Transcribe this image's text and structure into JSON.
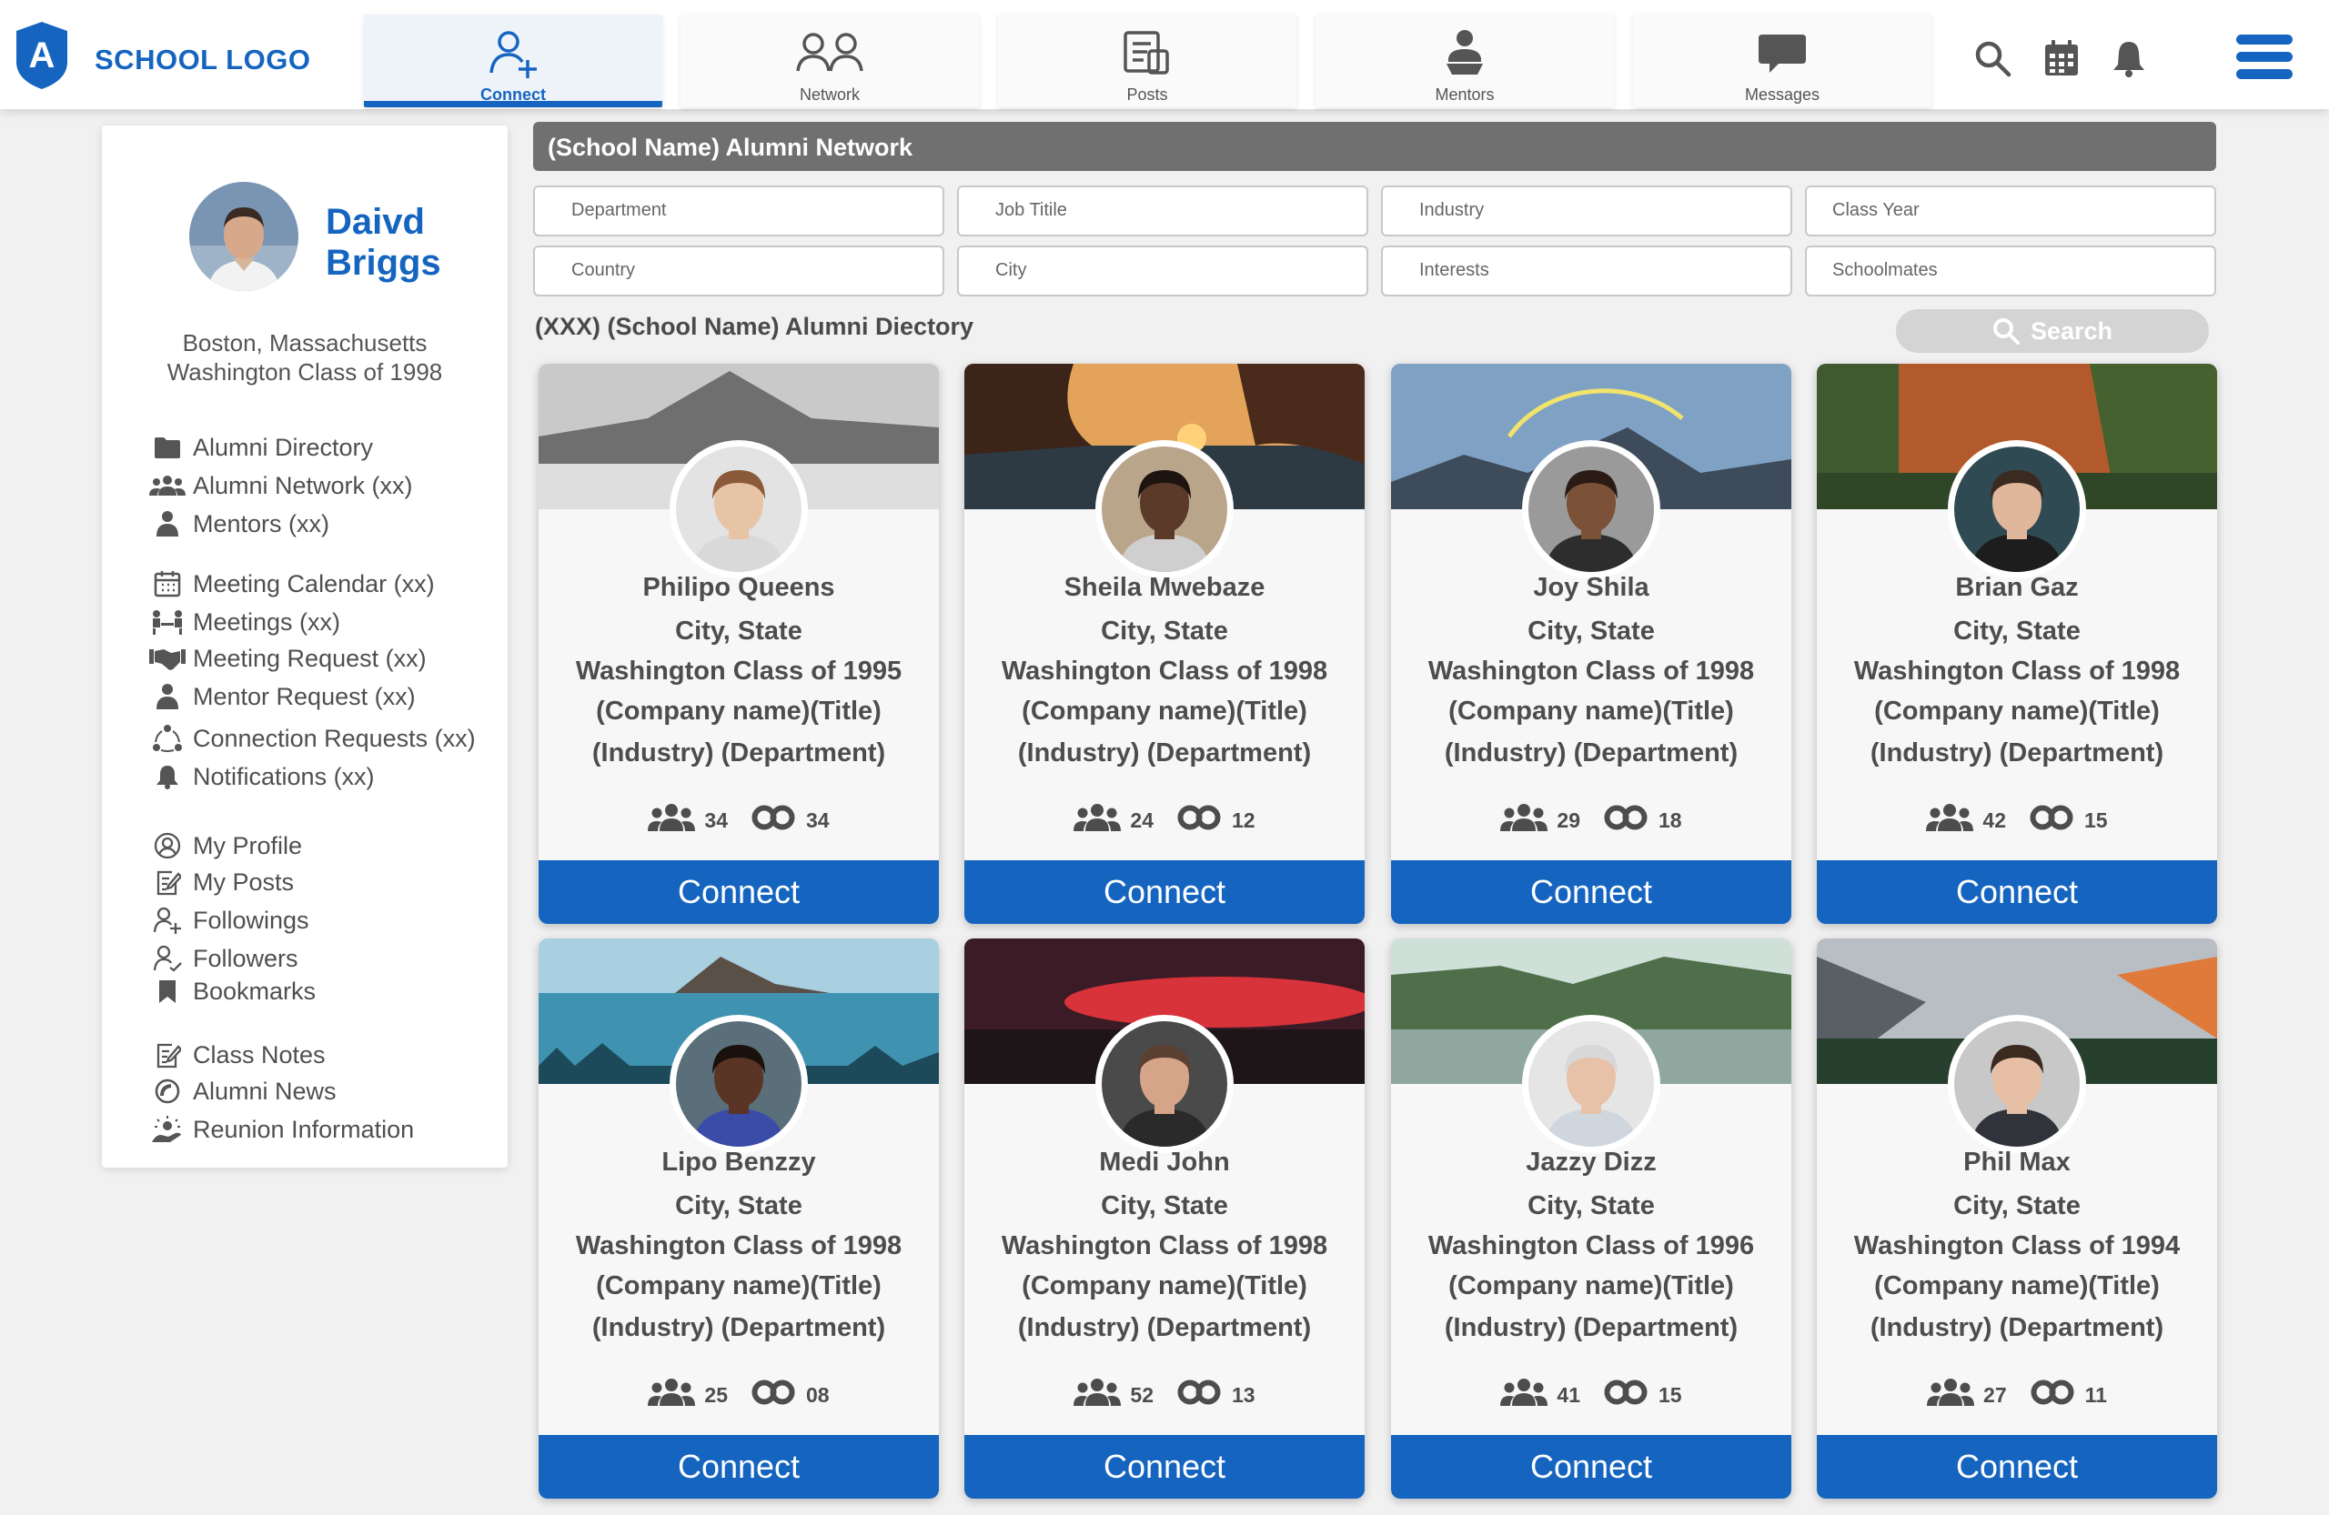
{
  "brand": {
    "logo_letter": "A",
    "logo_text": "SCHOOL LOGO",
    "accent": "#1565c0"
  },
  "nav": {
    "tabs": [
      {
        "label": "Connect",
        "icon": "connect-icon",
        "active": true
      },
      {
        "label": "Network",
        "icon": "network-icon"
      },
      {
        "label": "Posts",
        "icon": "posts-icon"
      },
      {
        "label": "Mentors",
        "icon": "mentors-icon"
      },
      {
        "label": "Messages",
        "icon": "messages-icon"
      }
    ],
    "icons": [
      "search-icon",
      "calendar-icon",
      "bell-icon",
      "hamburger-menu-icon"
    ]
  },
  "profile": {
    "first_name": "Daivd",
    "last_name": "Briggs",
    "location": "Boston, Massachusetts",
    "class": "Washington Class of 1998"
  },
  "menu": [
    {
      "label": "Alumni Directory",
      "icon": "folder-icon"
    },
    {
      "label": "Alumni Network (xx)",
      "icon": "group-icon"
    },
    {
      "label": "Mentors (xx)",
      "icon": "mentor-icon"
    },
    {
      "label": "Meeting Calendar (xx)",
      "icon": "calendar-icon"
    },
    {
      "label": "Meetings (xx)",
      "icon": "meetings-icon"
    },
    {
      "label": "Meeting Request (xx)",
      "icon": "handshake-icon"
    },
    {
      "label": "Mentor Request (xx)",
      "icon": "mentor-icon"
    },
    {
      "label": "Connection Requests (xx)",
      "icon": "connections-icon"
    },
    {
      "label": "Notifications (xx)",
      "icon": "bell-icon"
    },
    {
      "label": "My Profile",
      "icon": "profile-icon"
    },
    {
      "label": "My Posts",
      "icon": "edit-icon"
    },
    {
      "label": "Followings",
      "icon": "user-plus-icon"
    },
    {
      "label": "Followers",
      "icon": "user-check-icon"
    },
    {
      "label": "Bookmarks",
      "icon": "bookmark-icon"
    },
    {
      "label": "Class Notes",
      "icon": "edit-icon"
    },
    {
      "label": "Alumni News",
      "icon": "news-icon"
    },
    {
      "label": "Reunion Information",
      "icon": "reunion-icon"
    }
  ],
  "main": {
    "network_title": "(School Name) Alumni Network",
    "filters": [
      "Department",
      "Job Titile",
      "Industry",
      "Class Year",
      "Country",
      "City",
      "Interests",
      "Schoolmates"
    ],
    "directory_title": "(XXX) (School Name) Alumni Diectory",
    "search_label": "Search"
  },
  "cards": [
    {
      "name": "Philipo Queens",
      "city": "City, State",
      "class": "Washington Class of 1995",
      "company": "(Company name)(Title)",
      "industry": "(Industry) (Department)",
      "connections": "34",
      "mutual": "34",
      "connect": "Connect"
    },
    {
      "name": "Sheila Mwebaze",
      "city": "City, State",
      "class": "Washington Class of 1998",
      "company": "(Company name)(Title)",
      "industry": "(Industry) (Department)",
      "connections": "24",
      "mutual": "12",
      "connect": "Connect"
    },
    {
      "name": "Joy Shila",
      "city": "City, State",
      "class": "Washington Class of 1998",
      "company": "(Company name)(Title)",
      "industry": "(Industry) (Department)",
      "connections": "29",
      "mutual": "18",
      "connect": "Connect"
    },
    {
      "name": "Brian Gaz",
      "city": "City, State",
      "class": "Washington Class of 1998",
      "company": "(Company name)(Title)",
      "industry": "(Industry) (Department)",
      "connections": "42",
      "mutual": "15",
      "connect": "Connect"
    },
    {
      "name": "Lipo Benzzy",
      "city": "City, State",
      "class": "Washington Class of 1998",
      "company": "(Company name)(Title)",
      "industry": "(Industry) (Department)",
      "connections": "25",
      "mutual": "08",
      "connect": "Connect"
    },
    {
      "name": "Medi John",
      "city": "City, State",
      "class": "Washington Class of 1998",
      "company": "(Company name)(Title)",
      "industry": "(Industry) (Department)",
      "connections": "52",
      "mutual": "13",
      "connect": "Connect"
    },
    {
      "name": "Jazzy Dizz",
      "city": "City, State",
      "class": "Washington Class of 1996",
      "company": "(Company name)(Title)",
      "industry": "(Industry) (Department)",
      "connections": "41",
      "mutual": "15",
      "connect": "Connect"
    },
    {
      "name": "Phil Max",
      "city": "City, State",
      "class": "Washington Class of 1994",
      "company": "(Company name)(Title)",
      "industry": "(Industry) (Department)",
      "connections": "27",
      "mutual": "11",
      "connect": "Connect"
    }
  ]
}
